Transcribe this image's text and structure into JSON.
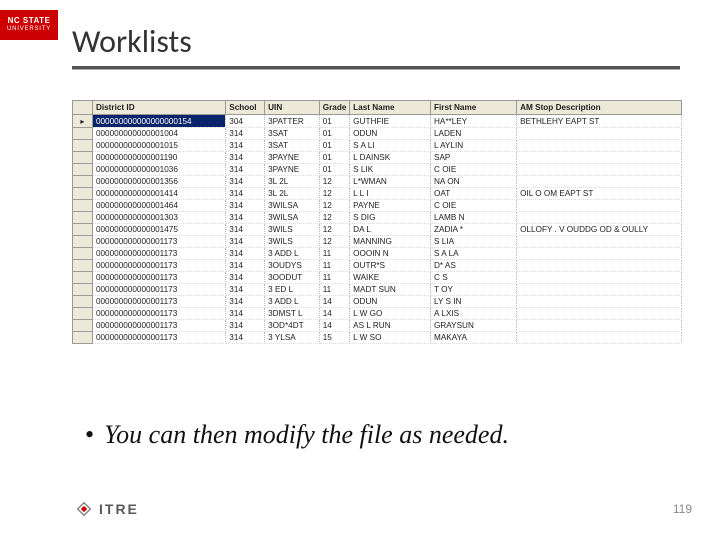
{
  "branding": {
    "ncsu_top": "NC STATE",
    "ncsu_bottom": "UNIVERSITY",
    "footer_logo_text": "ITRE"
  },
  "slide": {
    "title": "Worklists",
    "bullet1": "You can then modify the file as needed.",
    "page_number": "119"
  },
  "table": {
    "headers": {
      "district": "District ID",
      "school": "School",
      "uin": "UIN",
      "grade": "Grade",
      "last": "Last Name",
      "first": "First Name",
      "am": "AM Stop Description"
    },
    "rows": [
      {
        "marker": "▸",
        "district": "000000000000000000154",
        "school": "304",
        "uin": "3PATTER",
        "grade": "01",
        "last": "GUTHFIE",
        "first": "HA**LEY",
        "am": "BETHLEHY EAPT ST"
      },
      {
        "marker": "",
        "district": "000000000000001004",
        "school": "314",
        "uin": "3SAT",
        "grade": "01",
        "last": "ODUN",
        "first": "LADEN",
        "am": ""
      },
      {
        "marker": "",
        "district": "000000000000001015",
        "school": "314",
        "uin": "3SAT",
        "grade": "01",
        "last": "S A LI",
        "first": "L AYLIN",
        "am": ""
      },
      {
        "marker": "",
        "district": "000000000000001190",
        "school": "314",
        "uin": "3PAYNE",
        "grade": "01",
        "last": "L DAINSK",
        "first": "SAP",
        "am": ""
      },
      {
        "marker": "",
        "district": "000000000000001036",
        "school": "314",
        "uin": "3PAYNE",
        "grade": "01",
        "last": "S  LIK",
        "first": "C  OIE",
        "am": ""
      },
      {
        "marker": "",
        "district": "000000000000001356",
        "school": "314",
        "uin": "3L  2L",
        "grade": "12",
        "last": "L*WMAN",
        "first": "NA  ON",
        "am": ""
      },
      {
        "marker": "",
        "district": "000000000000001414",
        "school": "314",
        "uin": "3L  2L",
        "grade": "12",
        "last": "L  L I",
        "first": "OAT",
        "am": "OIL  O  OM EAPT ST"
      },
      {
        "marker": "",
        "district": "000000000000001464",
        "school": "314",
        "uin": "3WILSA",
        "grade": "12",
        "last": "PAYNE",
        "first": "C  OIE",
        "am": ""
      },
      {
        "marker": "",
        "district": "000000000000001303",
        "school": "314",
        "uin": "3WILSA",
        "grade": "12",
        "last": "S DIG",
        "first": "LAMB  N",
        "am": ""
      },
      {
        "marker": "",
        "district": "000000000000001475",
        "school": "314",
        "uin": "3WILS",
        "grade": "12",
        "last": "DA  L",
        "first": "ZADIA *",
        "am": "OLLOFY .  V OUDDG  OD & OULLY"
      },
      {
        "marker": "",
        "district": "000000000000001173",
        "school": "314",
        "uin": "3WILS",
        "grade": "12",
        "last": "MANNING",
        "first": "S   LIA",
        "am": ""
      },
      {
        "marker": "",
        "district": "000000000000001173",
        "school": "314",
        "uin": "3 ADD L",
        "grade": "11",
        "last": "OOOIN N",
        "first": "S  A LA",
        "am": ""
      },
      {
        "marker": "",
        "district": "000000000000001173",
        "school": "314",
        "uin": "3OUDYS",
        "grade": "11",
        "last": "OUTR*S",
        "first": "D* AS",
        "am": ""
      },
      {
        "marker": "",
        "district": "000000000000001173",
        "school": "314",
        "uin": "3OODUT",
        "grade": "11",
        "last": "WAIKE",
        "first": "C   S",
        "am": ""
      },
      {
        "marker": "",
        "district": "000000000000001173",
        "school": "314",
        "uin": "3 ED  L",
        "grade": "11",
        "last": "MADT SUN",
        "first": "T OY",
        "am": ""
      },
      {
        "marker": "",
        "district": "000000000000001173",
        "school": "314",
        "uin": "3 ADD L",
        "grade": "14",
        "last": "ODUN",
        "first": "LY  S IN",
        "am": ""
      },
      {
        "marker": "",
        "district": "000000000000001173",
        "school": "314",
        "uin": "3DMST L",
        "grade": "14",
        "last": "L  W GO",
        "first": "A LXIS",
        "am": ""
      },
      {
        "marker": "",
        "district": "000000000000001173",
        "school": "314",
        "uin": "3OD*4DT",
        "grade": "14",
        "last": "AS L  RUN",
        "first": "GRAYSUN",
        "am": ""
      },
      {
        "marker": "",
        "district": "000000000000001173",
        "school": "314",
        "uin": "3  YLSA",
        "grade": "15",
        "last": "L   W SO",
        "first": "MAKAYA",
        "am": ""
      }
    ]
  }
}
